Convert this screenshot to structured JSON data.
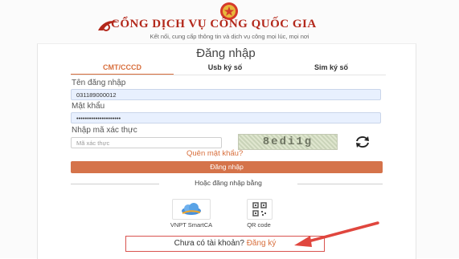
{
  "header": {
    "title": "CỔNG DỊCH VỤ CÔNG QUỐC GIA",
    "subtitle": "Kết nối, cung cấp thông tin và dịch vụ công mọi lúc, mọi nơi"
  },
  "login": {
    "heading": "Đăng nhập",
    "tabs": [
      {
        "label": "CMT/CCCD",
        "active": true
      },
      {
        "label": "Usb ký số",
        "active": false
      },
      {
        "label": "Sim ký số",
        "active": false
      }
    ],
    "username_label": "Tên đăng nhập",
    "username_value": "031189000012",
    "password_label": "Mật khẩu",
    "password_value": "•••••••••••••••••••••",
    "captcha_label": "Nhập mã xác thực",
    "captcha_placeholder": "Mã xác thực",
    "captcha_text": "8edi1g",
    "forgot_password": "Quên mật khẩu?",
    "submit_label": "Đăng nhập",
    "alt_divider": "Hoặc đăng nhập bằng",
    "alt_methods": [
      {
        "label": "VNPT SmartCA",
        "icon": "cloud-icon"
      },
      {
        "label": "QR code",
        "icon": "qr-code-icon"
      }
    ],
    "register_prompt": "Chưa có tài khoản?",
    "register_link": "Đăng ký"
  },
  "colors": {
    "brand_red": "#b3281b",
    "accent_orange": "#d5734a",
    "annotation_red": "#e0463e"
  }
}
